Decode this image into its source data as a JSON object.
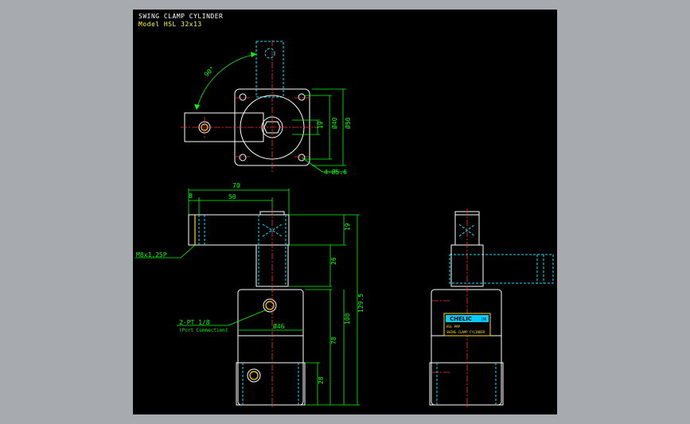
{
  "title": "SWING CLAMP CYLINDER",
  "model": "Model  HSL 32x13",
  "dims": {
    "angle": "90°",
    "d19": "19",
    "d40": "Ø40",
    "d50": "Ø50",
    "holes": "4-Ø5.6",
    "d70": "70",
    "d8": "8",
    "d50h": "50",
    "d19v": "19",
    "d26": "26",
    "d129": "129.5",
    "d108": "108",
    "d78": "78",
    "d28": "28",
    "d46": "Ø46"
  },
  "labels": {
    "thread": "M8x1.25P",
    "port": "2-PT 1/8",
    "port_sub": "(Port Connection)",
    "brand": "CHELIC",
    "brand_mark": "JM",
    "plate_model": "HSL ###",
    "plate_name": "SWING CLAMP CYLINDER"
  },
  "colors": {
    "background": "#000000",
    "frame": "#a7abb0",
    "outline": "#ffffff",
    "hidden": "#00e5ff",
    "center": "#ff3030",
    "dimension": "#00ff00"
  }
}
